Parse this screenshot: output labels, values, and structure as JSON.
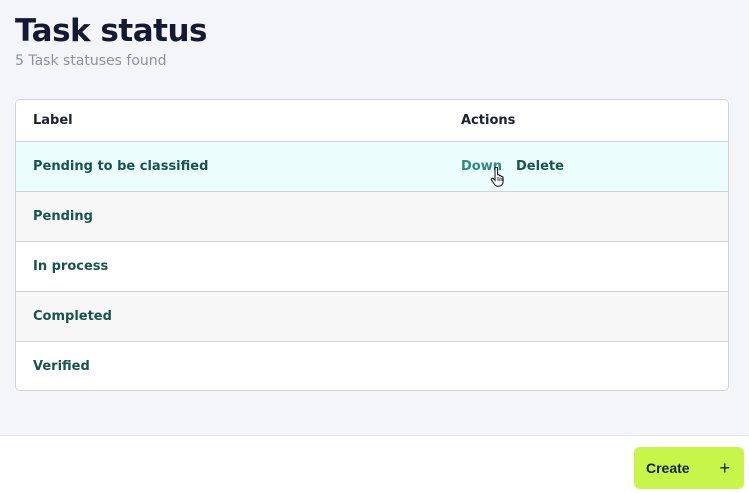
{
  "header": {
    "title": "Task status",
    "subtitle": "5 Task statuses found"
  },
  "table": {
    "columns": {
      "label": "Label",
      "actions": "Actions"
    },
    "rows": [
      {
        "label": "Pending to be classified"
      },
      {
        "label": "Pending"
      },
      {
        "label": "In process"
      },
      {
        "label": "Completed"
      },
      {
        "label": "Verified"
      }
    ],
    "hover_actions": {
      "down": "Down",
      "delete": "Delete"
    }
  },
  "footer": {
    "create_label": "Create",
    "create_icon": "plus-icon"
  },
  "colors": {
    "accent_button": "#c8f54a",
    "label_text": "#17544f",
    "hover_row": "#ecfdfd"
  }
}
